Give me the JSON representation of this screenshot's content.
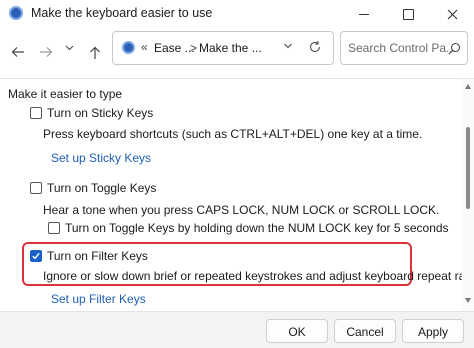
{
  "window": {
    "title": "Make the keyboard easier to use"
  },
  "nav": {
    "breadcrumb_separator": "«",
    "crumb1": "Ease ...",
    "crumb_chevron": ">",
    "crumb2": "Make the ...",
    "search_placeholder": "Search Control Pa..."
  },
  "content": {
    "section_title": "Make it easier to type",
    "sticky": {
      "label": "Turn on Sticky Keys",
      "checked": false,
      "description": "Press keyboard shortcuts (such as CTRL+ALT+DEL) one key at a time.",
      "link": "Set up Sticky Keys"
    },
    "toggle": {
      "label": "Turn on Toggle Keys",
      "checked": false,
      "description": "Hear a tone when you press CAPS LOCK, NUM LOCK or SCROLL LOCK.",
      "sub_label": "Turn on Toggle Keys by holding down the NUM LOCK key for 5 seconds",
      "sub_checked": false
    },
    "filter": {
      "label": "Turn on Filter Keys",
      "checked": true,
      "description": "Ignore or slow down brief or repeated keystrokes and adjust keyboard repeat rates.",
      "link": "Set up Filter Keys"
    }
  },
  "footer": {
    "ok": "OK",
    "cancel": "Cancel",
    "apply": "Apply"
  },
  "colors": {
    "accent": "#1a62c9",
    "link": "#1f5fb4",
    "highlight_border": "#d9333e"
  }
}
